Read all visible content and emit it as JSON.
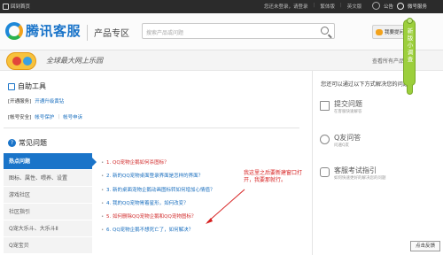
{
  "topbar": {
    "home_label": "回到首页",
    "links": [
      "您还未登录，请登录",
      "繁体版",
      "英文版"
    ],
    "notice": "公告",
    "service": "微号服务"
  },
  "header": {
    "logo_text": "腾讯客服",
    "product_zone": "产品专区",
    "search_placeholder": "搜索产品或问题",
    "ask_button": "我要提问"
  },
  "banner": {
    "slogan": "全球最大网上乐园",
    "see_all": "查看所有产品"
  },
  "self_tools": {
    "title": "自助工具",
    "rows": [
      {
        "label": "[开通服务]",
        "links": [
          "开通升级黄钻"
        ]
      },
      {
        "label": "[帐号安全]",
        "links": [
          "帐号保护",
          "帐号申诉"
        ]
      }
    ]
  },
  "faq": {
    "title": "常见问题",
    "tabs": [
      "热点问题",
      "图标、属性、喂养、设置",
      "游戏社区",
      "社区指引",
      "Q宠大乐斗、大乐斗Ⅱ",
      "Q宠宝贝"
    ],
    "questions": [
      "1. QQ宠物企鹅如何杀图标？",
      "2. 新的QQ宠物桌面登录界面是怎样的界面？",
      "3. 新的桌面宠物企鹅动画图标转如何增加心情值？",
      "4. 我的QQ宠物胃着星形，如何改变？",
      "5. 如何删除QQ宠物企鹅和QQ宠物图标？",
      "6. QQ宠物企鹅不想死亡了，如何解决？"
    ],
    "annotation": "我这里之后要新建窗口打开，我要那就行。"
  },
  "right_panel": {
    "title": "您还可以通过以下方式解决您的问题",
    "blocks": [
      {
        "name": "提交问题",
        "desc": "在客服快速解答"
      },
      {
        "name": "Q友问答",
        "desc": "问遍Q友"
      },
      {
        "name": "客服考试指引",
        "desc": "如何快速更好的解决您的问题"
      }
    ]
  },
  "sticker": {
    "text": "新版小调查"
  },
  "tooltip": {
    "text": "点击反馈"
  },
  "colors": {
    "brand_blue": "#1a74c9",
    "highlight_red": "#d12b2b",
    "sticker_green": "#9ccf3c",
    "topbar_dark": "#2b2b2b"
  }
}
